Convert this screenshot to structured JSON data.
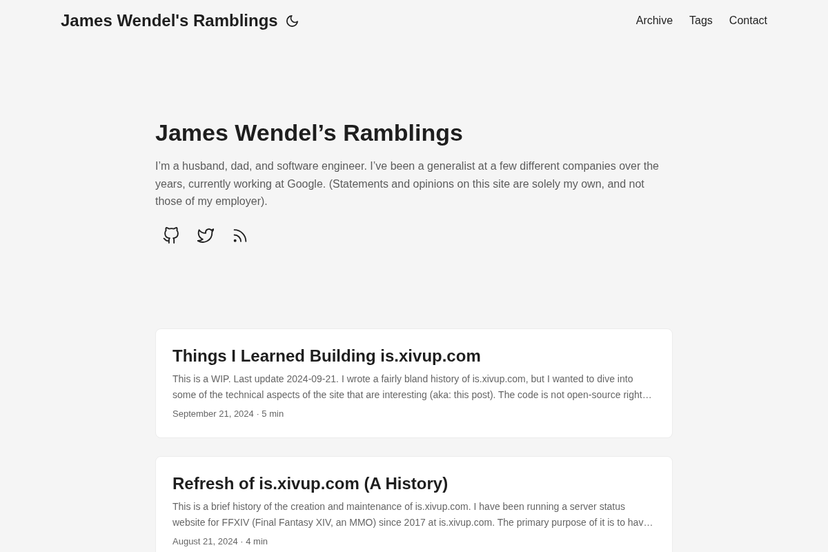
{
  "header": {
    "site_title": "James Wendel's Ramblings",
    "nav": [
      "Archive",
      "Tags",
      "Contact"
    ]
  },
  "hero": {
    "title": "James Wendel’s Ramblings",
    "bio": "I’m a husband, dad, and software engineer. I’ve been a generalist at a few different companies over the years, currently working at Google. (Statements and opinions on this site are solely my own, and not those of my employer).",
    "social_links": [
      {
        "kind": "github"
      },
      {
        "kind": "twitter"
      },
      {
        "kind": "rss"
      }
    ]
  },
  "posts": [
    {
      "title": "Things I Learned Building is.xivup.com",
      "summary": "This is a WIP. Last update 2024-09-21. I wrote a fairly bland history of is.xivup.com, but I wanted to dive into some of the technical aspects of the site that are interesting (aka: this post). The code is not open-source right…",
      "meta": "September 21, 2024 · 5 min"
    },
    {
      "title": "Refresh of is.xivup.com (A History)",
      "summary": "This is a brief history of the creation and maintenance of is.xivup.com. I have been running a server status website for FFXIV (Final Fantasy XIV, an MMO) since 2017 at is.xivup.com. The primary purpose of it is to hav…",
      "meta": "August 21, 2024 · 4 min"
    }
  ]
}
